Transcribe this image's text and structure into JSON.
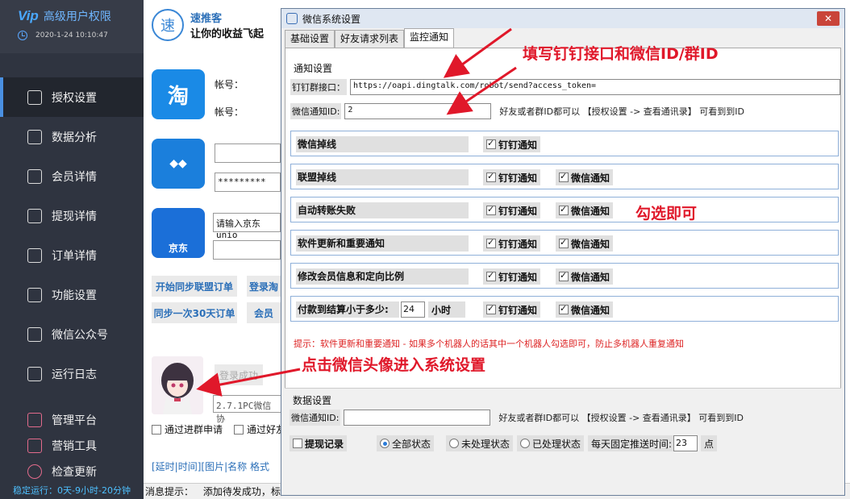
{
  "sidebar": {
    "logo": "Vip",
    "title": "高级用户权限",
    "datetime": "2020-1-24 10:10:47",
    "items": [
      {
        "label": "授权设置"
      },
      {
        "label": "数据分析"
      },
      {
        "label": "会员详情"
      },
      {
        "label": "提现详情"
      },
      {
        "label": "订单详情"
      },
      {
        "label": "功能设置"
      },
      {
        "label": "微信公众号"
      },
      {
        "label": "运行日志"
      }
    ],
    "bottom_items": [
      {
        "label": "管理平台"
      },
      {
        "label": "营销工具"
      },
      {
        "label": "检查更新"
      }
    ],
    "runtime": "稳定运行：0天-9小时-20分钟"
  },
  "main": {
    "logo_char": "速",
    "brand": "速推客",
    "slogan": "让你的收益飞起",
    "account_label": "帐号：",
    "taobao_label": "淘",
    "jd_label": "京东",
    "jd_placeholder": "请输入京东unio",
    "password_mask": "*********",
    "sync_label": "开始同步联盟订单",
    "login_label": "登录淘",
    "sync30_label": "同步一次30天订单",
    "member_label": "会员",
    "login_success": "登录成功",
    "version": "2.7.1PC微信协",
    "group_join": "通过进群申请",
    "friend_join": "通过好友",
    "tags": "[延时|时间][图片|名称 格式",
    "status_prefix": "消息提示：",
    "status_text": "添加待发成功，标题"
  },
  "dialog": {
    "title": "微信系统设置",
    "close": "✕",
    "tabs": [
      "基础设置",
      "好友请求列表",
      "监控通知"
    ],
    "notify_section": "通知设置",
    "dingtalk_label": "钉钉群接口：",
    "dingtalk_value": "https://oapi.dingtalk.com/robot/send?access_token=",
    "wechat_id_label": "微信通知ID:",
    "wechat_id_value": "2",
    "hint": "好友或者群ID都可以 【授权设置 -> 查看通讯录】 可看到到ID",
    "groups": [
      {
        "label": "微信掉线",
        "ding": true,
        "wx": null
      },
      {
        "label": "联盟掉线",
        "ding": true,
        "wx": true
      },
      {
        "label": "自动转账失败",
        "ding": true,
        "wx": true
      },
      {
        "label": "软件更新和重要通知",
        "ding": true,
        "wx": true
      },
      {
        "label": "修改会员信息和定向比例",
        "ding": true,
        "wx": true
      },
      {
        "label": "付款到结算小于多少:",
        "ding": true,
        "wx": true
      }
    ],
    "ding_label": "钉钉通知",
    "wx_label": "微信通知",
    "hours_value": "24",
    "hours_unit": "小时",
    "tip": "提示：软件更新和重要通知 - 如果多个机器人的话其中一个机器人勾选即可，防止多机器人重复通知",
    "data_section": "数据设置",
    "data_wechat_id_label": "微信通知ID:",
    "data_hint": "好友或者群ID都可以 【授权设置 -> 查看通讯录】 可看到到ID",
    "withdraw_label": "提现记录",
    "radio_all": "全部状态",
    "radio_pending": "未处理状态",
    "radio_done": "已处理状态",
    "push_time_label": "每天固定推送时间:",
    "push_time_value": "23",
    "push_time_unit": "点"
  },
  "annotations": {
    "top": "填写钉钉接口和微信ID/群ID",
    "middle": "勾选即可",
    "bottom": "点击微信头像进入系统设置"
  },
  "colors": {
    "annotation": "#e0182a",
    "sidebar_bg": "#2f3440",
    "accent": "#4a90e2"
  }
}
